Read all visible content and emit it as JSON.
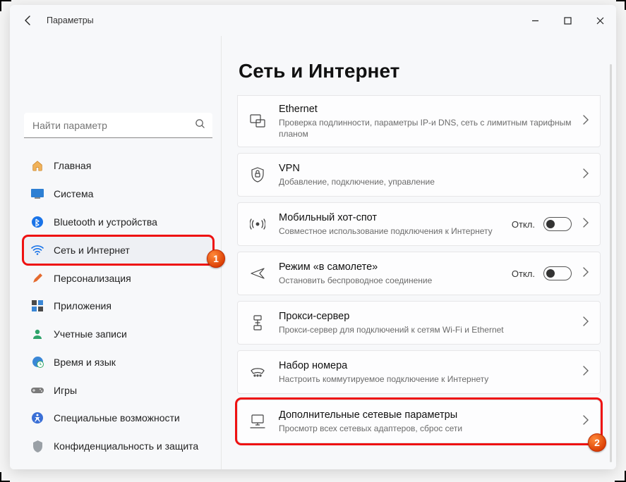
{
  "window": {
    "title": "Параметры"
  },
  "search": {
    "placeholder": "Найти параметр"
  },
  "sidebar": {
    "items": [
      {
        "label": "Главная"
      },
      {
        "label": "Система"
      },
      {
        "label": "Bluetooth и устройства"
      },
      {
        "label": "Сеть и Интернет"
      },
      {
        "label": "Персонализация"
      },
      {
        "label": "Приложения"
      },
      {
        "label": "Учетные записи"
      },
      {
        "label": "Время и язык"
      },
      {
        "label": "Игры"
      },
      {
        "label": "Специальные возможности"
      },
      {
        "label": "Конфиденциальность и защита"
      }
    ]
  },
  "page": {
    "title": "Сеть и Интернет"
  },
  "cards": [
    {
      "title": "Ethernet",
      "subtitle": "Проверка подлинности, параметры IP-и DNS, сеть с лимитным тарифным планом"
    },
    {
      "title": "VPN",
      "subtitle": "Добавление, подключение, управление"
    },
    {
      "title": "Мобильный хот-спот",
      "subtitle": "Совместное использование подключения к Интернету",
      "state": "Откл."
    },
    {
      "title": "Режим «в самолете»",
      "subtitle": "Остановить беспроводное соединение",
      "state": "Откл."
    },
    {
      "title": "Прокси-сервер",
      "subtitle": "Прокси-сервер для подключений к сетям Wi-Fi и Ethernet"
    },
    {
      "title": "Набор номера",
      "subtitle": "Настроить коммутируемое подключение к Интернету"
    },
    {
      "title": "Дополнительные сетевые параметры",
      "subtitle": "Просмотр всех сетевых адаптеров, сброс сети"
    }
  ],
  "callouts": {
    "one": "1",
    "two": "2"
  }
}
